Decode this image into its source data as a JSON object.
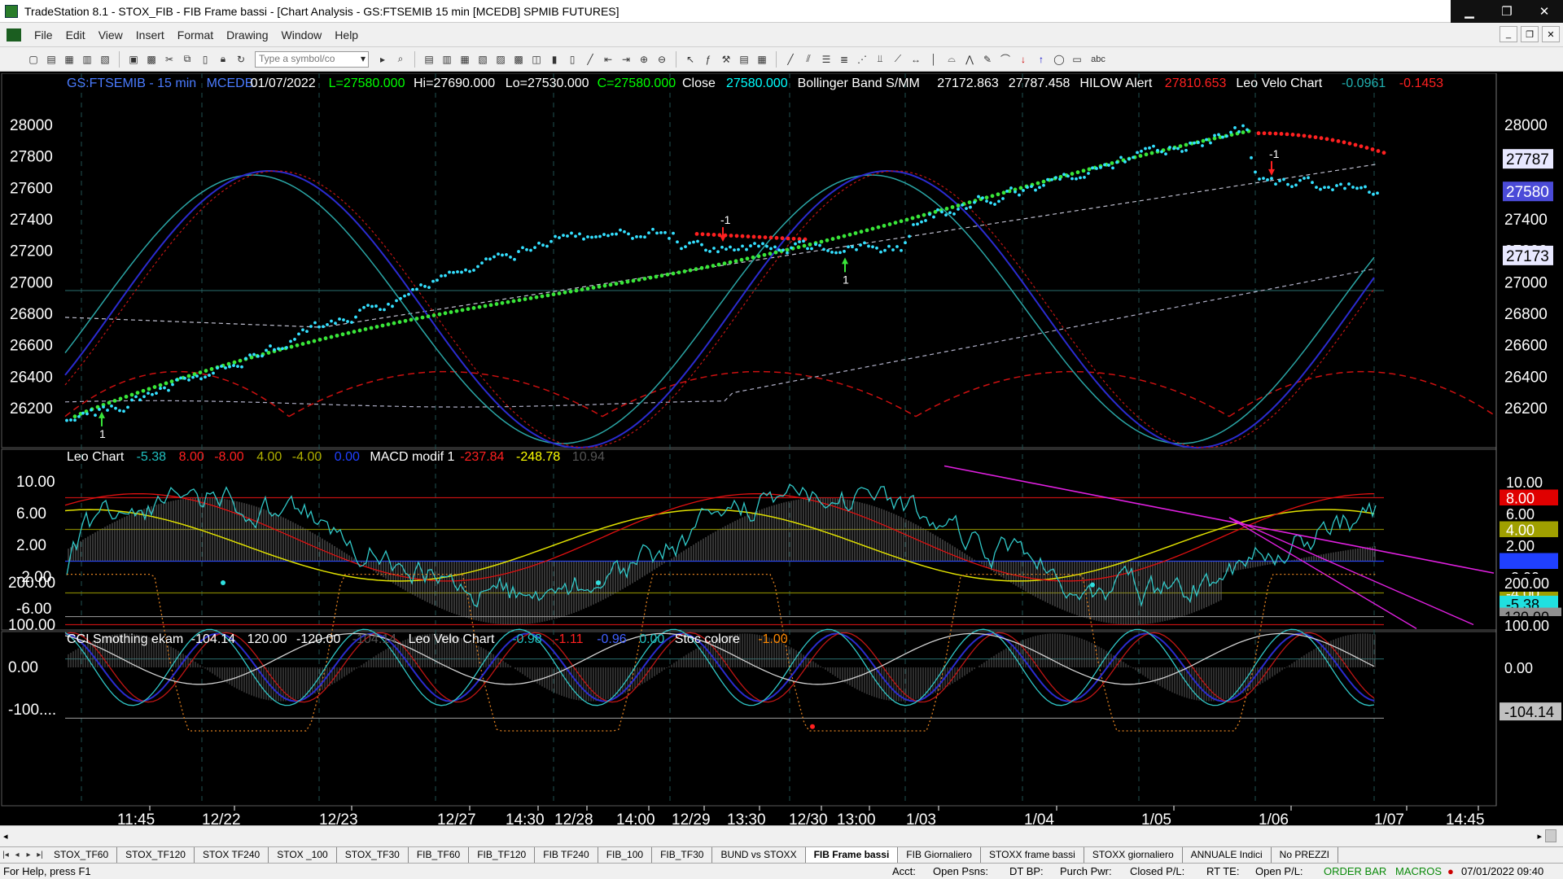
{
  "window": {
    "title": "TradeStation 8.1 - STOX_FIB - FIB Frame bassi - [Chart Analysis - GS:FTSEMIB  15 min  [MCEDB] SPMIB FUTURES]"
  },
  "menu": [
    "File",
    "Edit",
    "View",
    "Insert",
    "Format",
    "Drawing",
    "Window",
    "Help"
  ],
  "toolbar": {
    "symbol_placeholder": "Type a symbol/co",
    "text_tool": "abc"
  },
  "chart": {
    "header": [
      {
        "t": "GS:FTSEMIB - 15 min",
        "c": "#4a7bff"
      },
      {
        "t": "MCEDB",
        "c": "#4a7bff"
      },
      {
        "t": "01/07/2022",
        "c": "#ffffff"
      },
      {
        "t": "L=27580.000",
        "c": "#00ff00"
      },
      {
        "t": "Hi=27690.000",
        "c": "#ffffff"
      },
      {
        "t": "Lo=27530.000",
        "c": "#ffffff"
      },
      {
        "t": "C=27580.000",
        "c": "#00ff00"
      },
      {
        "t": "Close",
        "c": "#ffffff"
      },
      {
        "t": "27580.000",
        "c": "#00ffff"
      },
      {
        "t": "Bollinger Band S/MM",
        "c": "#ffffff"
      },
      {
        "t": "27172.863",
        "c": "#ffffff"
      },
      {
        "t": "27787.458",
        "c": "#ffffff"
      },
      {
        "t": "HILOW Alert",
        "c": "#ffffff"
      },
      {
        "t": "27810.653",
        "c": "#ff2020"
      },
      {
        "t": "Leo Velo Chart",
        "c": "#ffffff"
      },
      {
        "t": "-0.0961",
        "c": "#20b0b0"
      },
      {
        "t": "-0.1453",
        "c": "#ff2020"
      }
    ],
    "price_axis": [
      "28000",
      "27800",
      "27600",
      "27400",
      "27200",
      "27000",
      "26800",
      "26600",
      "26400",
      "26200"
    ],
    "price_tags": [
      {
        "t": "27787",
        "bg": "#e8e8ff",
        "fg": "#000000"
      },
      {
        "t": "27580",
        "bg": "#4b4bd8",
        "fg": "#ffffff"
      },
      {
        "t": "27173",
        "bg": "#e8e8ff",
        "fg": "#000000"
      }
    ],
    "alerts": [
      {
        "t": "1",
        "dir": "up"
      },
      {
        "t": "-1",
        "dir": "down"
      },
      {
        "t": "1",
        "dir": "up"
      },
      {
        "t": "-1",
        "dir": "down"
      }
    ],
    "sub1": {
      "header": [
        {
          "t": "Leo Chart",
          "c": "#ffffff"
        },
        {
          "t": "-5.38",
          "c": "#20c0c0"
        },
        {
          "t": "8.00",
          "c": "#ff2020"
        },
        {
          "t": "-8.00",
          "c": "#ff2020"
        },
        {
          "t": "4.00",
          "c": "#b0b000"
        },
        {
          "t": "-4.00",
          "c": "#b0b000"
        },
        {
          "t": "0.00",
          "c": "#2040ff"
        },
        {
          "t": "MACD modif 1",
          "c": "#ffffff"
        },
        {
          "t": "-237.84",
          "c": "#ff2020"
        },
        {
          "t": "-248.78",
          "c": "#ffff00"
        },
        {
          "t": "10.94",
          "c": "#555555"
        }
      ],
      "axis": [
        "10.00",
        "6.00",
        "2.00",
        "-2.00",
        "-6.00"
      ],
      "tags": [
        {
          "t": "10.00",
          "bg": "#000000",
          "fg": "#ffffff"
        },
        {
          "t": "8.00",
          "bg": "#e00000",
          "fg": "#ffffff"
        },
        {
          "t": "6.00",
          "bg": "#000000",
          "fg": "#ffffff"
        },
        {
          "t": "4.00",
          "bg": "#a0a000",
          "fg": "#ffffff"
        },
        {
          "t": "2.00",
          "bg": "#000000",
          "fg": "#ffffff"
        },
        {
          "t": "0.00",
          "bg": "#2040ff",
          "fg": "#2040ff"
        },
        {
          "t": "-2.00",
          "bg": "#000000",
          "fg": "#ffffff"
        },
        {
          "t": "-4.00",
          "bg": "#a0a000",
          "fg": "#ffffff"
        },
        {
          "t": "-5.38",
          "bg": "#20e0e0",
          "fg": "#000000"
        },
        {
          "t": "-8.00",
          "bg": "#e00000",
          "fg": "#ffffff"
        }
      ]
    },
    "sub2": {
      "header": [
        {
          "t": "CCI Smothing ekam",
          "c": "#ffffff"
        },
        {
          "t": "-104.14",
          "c": "#ffffff"
        },
        {
          "t": "120.00",
          "c": "#ffffff"
        },
        {
          "t": "-120.00",
          "c": "#ffffff"
        },
        {
          "t": "-104.14",
          "c": "#555555"
        },
        {
          "t": "Leo Velo Chart",
          "c": "#ffffff"
        },
        {
          "t": "-0.98",
          "c": "#20c0c0"
        },
        {
          "t": "-1.11",
          "c": "#ff2020"
        },
        {
          "t": "-0.96",
          "c": "#4060ff"
        },
        {
          "t": "0.00",
          "c": "#20c0c0"
        },
        {
          "t": "Stoc colore",
          "c": "#ffffff"
        },
        {
          "t": "-1.00",
          "c": "#ff8800"
        }
      ],
      "axis": [
        "200.00",
        "100.00",
        "0.00",
        "-100...."
      ],
      "tags": [
        {
          "t": "200.00",
          "bg": "#000000",
          "fg": "#ffffff"
        },
        {
          "t": "120.00",
          "bg": "#909090",
          "fg": "#000000"
        },
        {
          "t": "100.00",
          "bg": "#000000",
          "fg": "#ffffff"
        },
        {
          "t": "0.00",
          "bg": "#000000",
          "fg": "#ffffff"
        },
        {
          "t": "-104.14",
          "bg": "#c0c0c0",
          "fg": "#000000"
        }
      ]
    },
    "time_axis": [
      "11:45",
      "12/22",
      "12/23",
      "12/27",
      "14:30",
      "12/28",
      "14:00",
      "12/29",
      "13:30",
      "12/30",
      "13:00",
      "1/03",
      "1/04",
      "1/05",
      "1/06",
      "1/07",
      "14:45"
    ]
  },
  "tabs": [
    {
      "label": "STOX_TF60",
      "active": false
    },
    {
      "label": "STOX_TF120",
      "active": false
    },
    {
      "label": "STOX TF240",
      "active": false
    },
    {
      "label": "STOX _100",
      "active": false
    },
    {
      "label": "STOX_TF30",
      "active": false
    },
    {
      "label": "FIB_TF60",
      "active": false
    },
    {
      "label": "FIB_TF120",
      "active": false
    },
    {
      "label": "FIB TF240",
      "active": false
    },
    {
      "label": "FIB_100",
      "active": false
    },
    {
      "label": "FIB_TF30",
      "active": false
    },
    {
      "label": "BUND vs STOXX",
      "active": false
    },
    {
      "label": "FIB Frame bassi",
      "active": true
    },
    {
      "label": "FIB Giornaliero",
      "active": false
    },
    {
      "label": "STOXX frame bassi",
      "active": false
    },
    {
      "label": "STOXX giornaliero",
      "active": false
    },
    {
      "label": "ANNUALE Indici",
      "active": false
    },
    {
      "label": "No PREZZI",
      "active": false
    }
  ],
  "status": {
    "help": "For Help, press F1",
    "acct": "Acct:",
    "open_psns": "Open Psns:",
    "dt_bp": "DT BP:",
    "purch_pwr": "Purch Pwr:",
    "closed_pl": "Closed P/L:",
    "rt_te": "RT TE:",
    "open_pl": "Open P/L:",
    "order_bar": "ORDER BAR",
    "macros": "MACROS",
    "datetime": "07/01/2022 09:40"
  }
}
